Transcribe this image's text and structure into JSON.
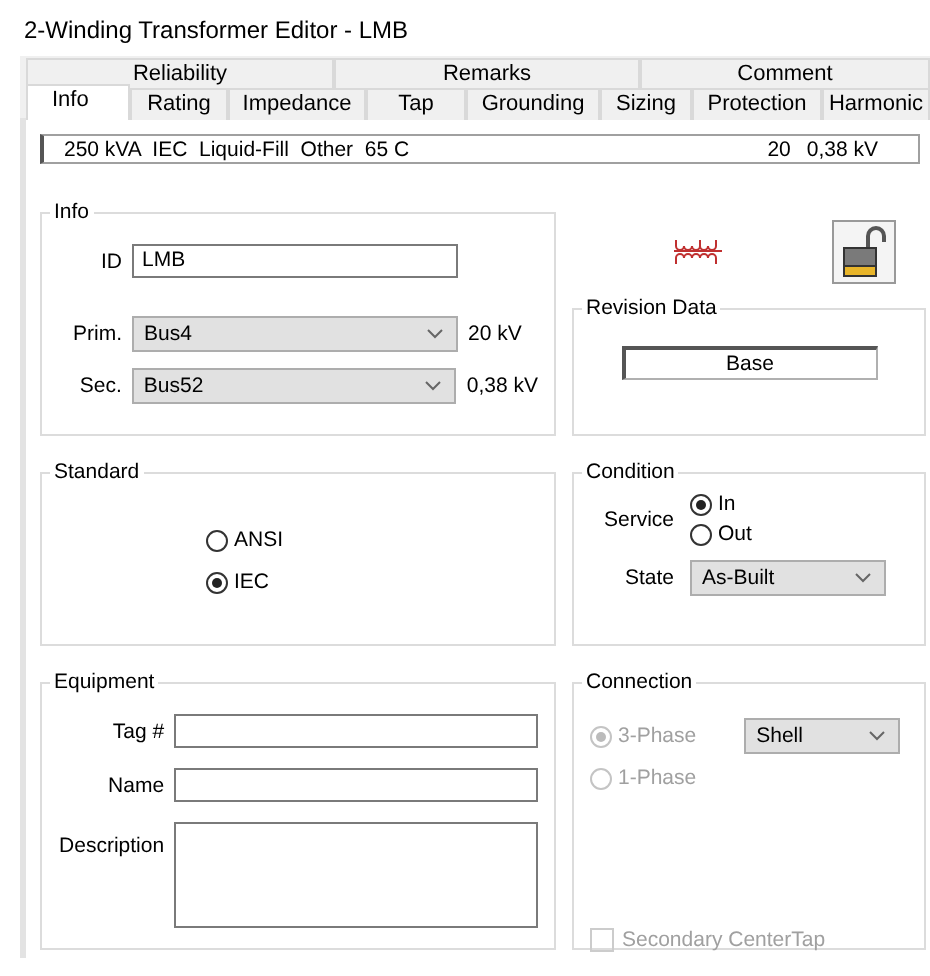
{
  "window": {
    "title": "2-Winding Transformer Editor - LMB"
  },
  "back_tabs": [
    {
      "label": "Reliability",
      "selected": false
    },
    {
      "label": "Remarks",
      "selected": false
    },
    {
      "label": "Comment",
      "selected": false
    }
  ],
  "front_tabs": [
    {
      "label": "Info",
      "selected": true
    },
    {
      "label": "Rating",
      "selected": false
    },
    {
      "label": "Impedance",
      "selected": false
    },
    {
      "label": "Tap",
      "selected": false
    },
    {
      "label": "Grounding",
      "selected": false
    },
    {
      "label": "Sizing",
      "selected": false
    },
    {
      "label": "Protection",
      "selected": false
    },
    {
      "label": "Harmonic",
      "selected": false
    }
  ],
  "summary": {
    "description": "250 kVA  IEC  Liquid-Fill  Other  65 C",
    "rating": "20",
    "voltage": "0,38 kV"
  },
  "info": {
    "title": "Info",
    "id": {
      "label": "ID",
      "value": "LMB"
    },
    "buses": [
      {
        "label": "Prim.",
        "value": "Bus4",
        "reading": "20 kV"
      },
      {
        "label": "Sec.",
        "value": "Bus52",
        "reading": "0,38 kV"
      }
    ]
  },
  "revision_data": {
    "title": "Revision Data",
    "value": "Base"
  },
  "standard": {
    "title": "Standard",
    "options": [
      {
        "label": "ANSI",
        "selected": false
      },
      {
        "label": "IEC",
        "selected": true
      }
    ]
  },
  "condition": {
    "title": "Condition",
    "service": {
      "label": "Service",
      "options": [
        {
          "label": "In",
          "selected": true
        },
        {
          "label": "Out",
          "selected": false
        }
      ]
    },
    "state": {
      "label": "State",
      "value": "As-Built"
    }
  },
  "equipment": {
    "title": "Equipment",
    "fields": [
      {
        "label": "Tag #",
        "kind": "line"
      },
      {
        "label": "Name",
        "kind": "line"
      },
      {
        "label": "Description",
        "kind": "area"
      }
    ]
  },
  "connection": {
    "title": "Connection",
    "disabled": true,
    "options": [
      {
        "label": "3-Phase",
        "selected": true
      },
      {
        "label": "1-Phase",
        "selected": false
      }
    ],
    "type": "Shell",
    "center_tap": {
      "label": "Secondary CenterTap",
      "checked": false
    }
  }
}
